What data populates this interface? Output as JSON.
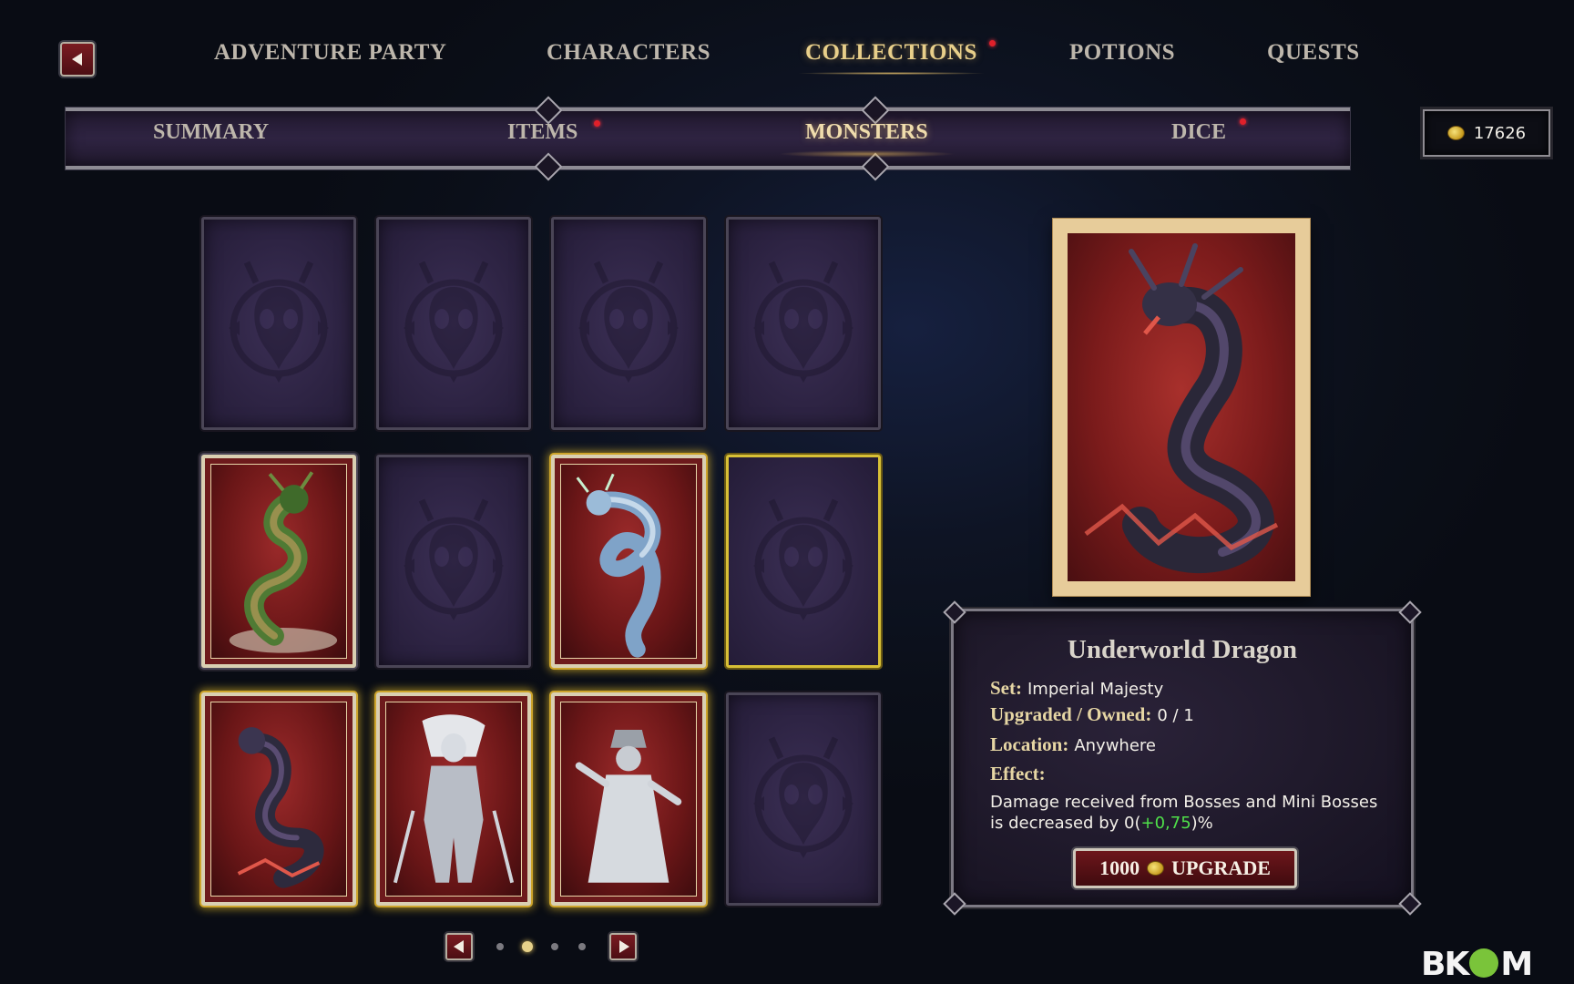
{
  "top_nav": {
    "tabs": [
      {
        "label": "ADVENTURE PARTY",
        "active": false,
        "notification": false
      },
      {
        "label": "CHARACTERS",
        "active": false,
        "notification": false
      },
      {
        "label": "COLLECTIONS",
        "active": true,
        "notification": true
      },
      {
        "label": "POTIONS",
        "active": false,
        "notification": false
      },
      {
        "label": "QUESTS",
        "active": false,
        "notification": false
      }
    ]
  },
  "sub_nav": {
    "tabs": [
      {
        "label": "SUMMARY",
        "active": false,
        "notification": false
      },
      {
        "label": "ITEMS",
        "active": false,
        "notification": true
      },
      {
        "label": "MONSTERS",
        "active": true,
        "notification": false
      },
      {
        "label": "DICE",
        "active": false,
        "notification": true
      }
    ]
  },
  "gold": {
    "icon": "coin-icon",
    "amount": "17626"
  },
  "grid": {
    "cards": [
      {
        "state": "empty"
      },
      {
        "state": "empty"
      },
      {
        "state": "empty"
      },
      {
        "state": "empty"
      },
      {
        "state": "owned",
        "monster": "green-dragon"
      },
      {
        "state": "empty"
      },
      {
        "state": "owned",
        "monster": "blue-dragon",
        "highlight": "gold"
      },
      {
        "state": "empty",
        "selected": true
      },
      {
        "state": "owned",
        "monster": "underworld-dragon",
        "highlight": "gold",
        "selected": true
      },
      {
        "state": "owned",
        "monster": "banshee-knight",
        "highlight": "gold"
      },
      {
        "state": "owned",
        "monster": "ghost-monk",
        "highlight": "gold"
      },
      {
        "state": "empty"
      }
    ]
  },
  "pager": {
    "pages": 4,
    "current": 2
  },
  "detail": {
    "title": "Underworld Dragon",
    "set_label": "Set:",
    "set_value": "Imperial Majesty",
    "upgraded_label": "Upgraded / Owned:",
    "upgraded_value": "0 / 1",
    "location_label": "Location:",
    "location_value": "Anywhere",
    "effect_label": "Effect:",
    "effect_text_before": "Damage received from Bosses and Mini Bosses is decreased by 0(",
    "effect_bonus": "+0,75",
    "effect_text_after": ")%",
    "upgrade_cost": "1000",
    "upgrade_label": "UPGRADE"
  },
  "logo": {
    "text_left": "BK",
    "text_right": "M"
  },
  "colors": {
    "accent_gold": "#e8cf8a",
    "bonus_green": "#4fe04a",
    "button_red": "#6d161b"
  }
}
